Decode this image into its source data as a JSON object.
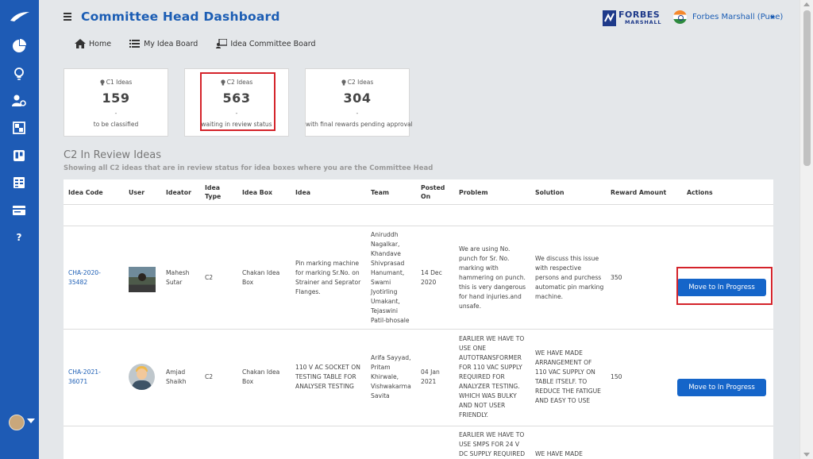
{
  "header": {
    "title": "Committee Head Dashboard",
    "brand_name": "FORBES",
    "brand_sub": "MARSHALL",
    "user_name": "Forbes Marshall (Pune)"
  },
  "nav": {
    "items": [
      {
        "label": "Home",
        "icon": "home-icon"
      },
      {
        "label": "My Idea Board",
        "icon": "list-icon"
      },
      {
        "label": "Idea Committee Board",
        "icon": "committee-icon"
      }
    ]
  },
  "sidebar": {
    "icons": [
      "logo-icon",
      "dashboard-icon",
      "bulb-icon",
      "user-settings-icon",
      "board-icon",
      "trello-icon",
      "grid-icon",
      "card-icon",
      "help-icon"
    ],
    "help_label": "?"
  },
  "cards": [
    {
      "label": "C1 Ideas",
      "count": "159",
      "dash": "-",
      "sub": "to be classified"
    },
    {
      "label": "C2 Ideas",
      "count": "563",
      "dash": "-",
      "sub": "waiting in review status"
    },
    {
      "label": "C2 Ideas",
      "count": "304",
      "dash": "-",
      "sub": "with final rewards pending approval"
    }
  ],
  "section": {
    "title": "C2 In Review Ideas",
    "subtitle": "Showing all C2 ideas that are in review status for idea boxes where you are the Committee Head"
  },
  "table": {
    "columns": {
      "idea_code": "Idea Code",
      "user": "User",
      "ideator": "Ideator",
      "idea_type_1": "Idea",
      "idea_type_2": "Type",
      "idea_box": "Idea Box",
      "idea": "Idea",
      "team": "Team",
      "posted_1": "Posted",
      "posted_2": "On",
      "problem": "Problem",
      "solution": "Solution",
      "reward": "Reward Amount",
      "actions": "Actions"
    },
    "rows": [
      {
        "code_1": "CHA-2020-",
        "code_2": "35482",
        "ideator_1": "Mahesh",
        "ideator_2": "Sutar",
        "type": "C2",
        "box_1": "Chakan Idea",
        "box_2": "Box",
        "idea_lines": [
          "Pin marking machine",
          "for marking Sr.No. on",
          "Strainer and Seprator",
          "Flanges."
        ],
        "team_lines": [
          "Aniruddh",
          "Nagalkar,",
          "Khandave",
          "Shivprasad",
          "Hanumant,",
          "Swami",
          "Jyotirling",
          "Umakant,",
          "Tejaswini",
          "Patil-bhosale"
        ],
        "posted_1": "14 Dec",
        "posted_2": "2020",
        "problem_lines": [
          "We are using No.",
          "punch for Sr. No.",
          "marking with",
          "hammering on punch.",
          "this is very dangerous",
          "for hand injuries.and",
          "unsafe."
        ],
        "solution_lines": [
          "We discuss this issue",
          "with respective",
          "persons and purchess",
          "automatic pin marking",
          "machine."
        ],
        "reward": "350",
        "action": "Move to In Progress"
      },
      {
        "code_1": "CHA-2021-",
        "code_2": "36071",
        "ideator_1": "Amjad",
        "ideator_2": "Shaikh",
        "type": "C2",
        "box_1": "Chakan Idea",
        "box_2": "Box",
        "idea_lines": [
          "110 V AC SOCKET ON",
          "TESTING TABLE FOR",
          "ANALYSER TESTING"
        ],
        "team_lines": [
          "Arifa Sayyad,",
          "Pritam",
          "Khirwale,",
          "Vishwakarma",
          "Savita"
        ],
        "posted_1": "04 Jan",
        "posted_2": "2021",
        "problem_lines": [
          "EARLIER WE HAVE TO",
          "USE ONE",
          "AUTOTRANSFORMER",
          "FOR 110 VAC SUPPLY",
          "REQUIRED FOR",
          "ANALYZER TESTING.",
          "WHICH WAS BULKY",
          "AND NOT USER",
          "FRIENDLY."
        ],
        "solution_lines": [
          "WE HAVE MADE",
          "ARRANGEMENT OF",
          "110 VAC SUPPLY ON",
          "TABLE ITSELF. TO",
          "REDUCE THE FATIGUE",
          "AND EASY TO USE"
        ],
        "reward": "150",
        "action": "Move to In Progress"
      },
      {
        "problem_lines": [
          "EARLIER WE HAVE TO",
          "USE SMPS FOR 24 V",
          "DC SUPPLY REQUIRED"
        ],
        "solution_lines": [
          "WE HAVE MADE"
        ]
      }
    ]
  }
}
